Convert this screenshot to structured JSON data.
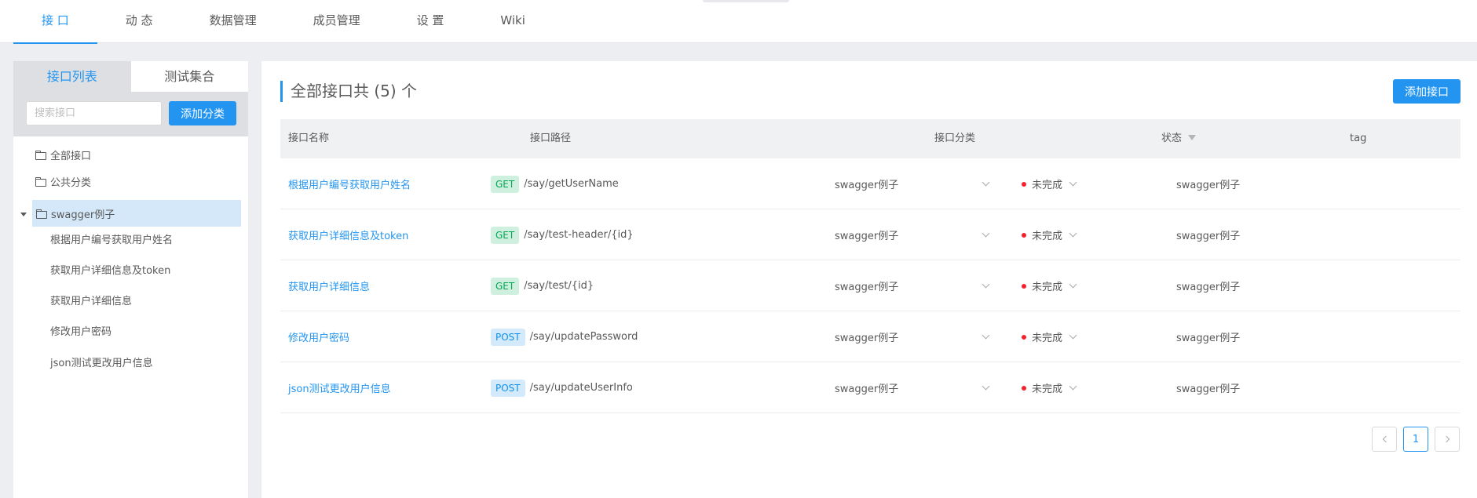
{
  "topnav": {
    "tabs": [
      {
        "label": "接 口",
        "active": true
      },
      {
        "label": "动 态"
      },
      {
        "label": "数据管理"
      },
      {
        "label": "成员管理"
      },
      {
        "label": "设 置"
      },
      {
        "label": "Wiki"
      }
    ]
  },
  "left": {
    "tabs": [
      "接口列表",
      "测试集合"
    ],
    "search_placeholder": "搜索接口",
    "add_category": "添加分类",
    "tree": {
      "all": "全部接口",
      "public": "公共分类",
      "swagger": "swagger例子",
      "children": [
        "根据用户编号获取用户姓名",
        "获取用户详细信息及token",
        "获取用户详细信息",
        "修改用户密码",
        "json测试更改用户信息"
      ]
    }
  },
  "main": {
    "title": "全部接口共 (5) 个",
    "add_button": "添加接口",
    "columns": [
      "接口名称",
      "接口路径",
      "接口分类",
      "状态",
      "tag"
    ],
    "rows": [
      {
        "name": "根据用户编号获取用户姓名",
        "method": "GET",
        "path": "/say/getUserName",
        "category": "swagger例子",
        "status": "未完成",
        "tag": "swagger例子"
      },
      {
        "name": "获取用户详细信息及token",
        "method": "GET",
        "path": "/say/test-header/{id}",
        "category": "swagger例子",
        "status": "未完成",
        "tag": "swagger例子"
      },
      {
        "name": "获取用户详细信息",
        "method": "GET",
        "path": "/say/test/{id}",
        "category": "swagger例子",
        "status": "未完成",
        "tag": "swagger例子"
      },
      {
        "name": "修改用户密码",
        "method": "POST",
        "path": "/say/updatePassword",
        "category": "swagger例子",
        "status": "未完成",
        "tag": "swagger例子"
      },
      {
        "name": "json测试更改用户信息",
        "method": "POST",
        "path": "/say/updateUserInfo",
        "category": "swagger例子",
        "status": "未完成",
        "tag": "swagger例子"
      }
    ],
    "pagination": {
      "current": "1"
    }
  },
  "colors": {
    "accent": "#2395f1",
    "status_dot": "#f5222d",
    "get_bg": "#cfefdf",
    "post_bg": "#d2eafb"
  },
  "icons": [
    "folder-icon",
    "caret-down-icon",
    "chevron-down-icon",
    "filter-icon",
    "chevron-left-icon",
    "chevron-right-icon"
  ]
}
